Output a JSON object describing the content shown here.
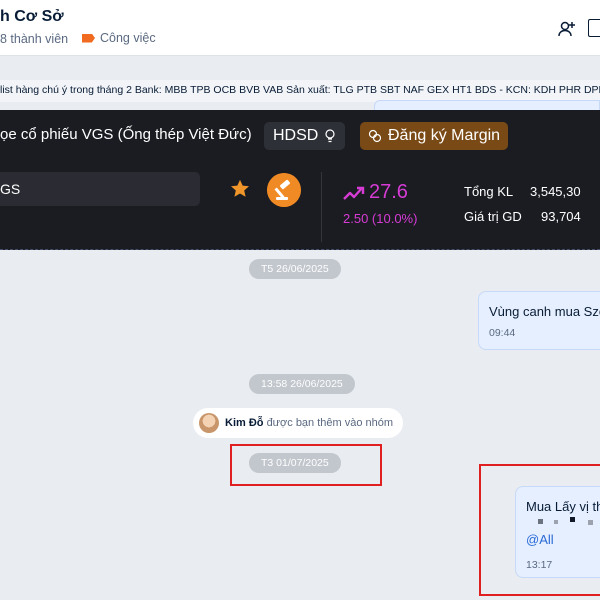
{
  "header": {
    "title": "h Cơ Sở",
    "members": "8 thành viên",
    "label": "Công việc"
  },
  "ticker_text": "list hàng chú ý trong tháng 2 Bank: MBB TPB OCB BVB VAB Sản xuất: TLG PTB SBT NAF GEX HT1 BDS - KCN: KDH PHR DPR C",
  "stock_card": {
    "name": "ọe cổ phiếu VGS (Ống thép Việt Đức)",
    "hdsd_label": "HDSD",
    "margin_label": "Đăng ký Margin",
    "symbol_value": "GS",
    "price": "27.6",
    "change": "2.50 (10.0%)",
    "stats": [
      {
        "label": "Tổng KL",
        "value": "3,545,30"
      },
      {
        "label": "Giá trị GD",
        "value": "93,704"
      }
    ],
    "colors": {
      "price": "#d63bd4",
      "gavel": "#f08a24",
      "star": "#f0952a",
      "margin_bg": "#7a4a16"
    }
  },
  "chat": {
    "date1": "T5 26/06/2025",
    "msg1": {
      "text": "Vùng canh mua Szc",
      "time": "09:44"
    },
    "date2": "13:58 26/06/2025",
    "notice": {
      "name": "Kim Đỗ",
      "text": "được bạn thêm vào nhóm"
    },
    "date3": "T3 01/07/2025",
    "msg2": {
      "text": "Mua Lấy vị th",
      "mention": "@All",
      "time": "13:17"
    }
  },
  "icons": [
    "add-member-icon",
    "more-icon",
    "bulb-icon",
    "coin-icon",
    "star-icon",
    "gavel-icon",
    "trend-up-icon",
    "tag-icon"
  ]
}
